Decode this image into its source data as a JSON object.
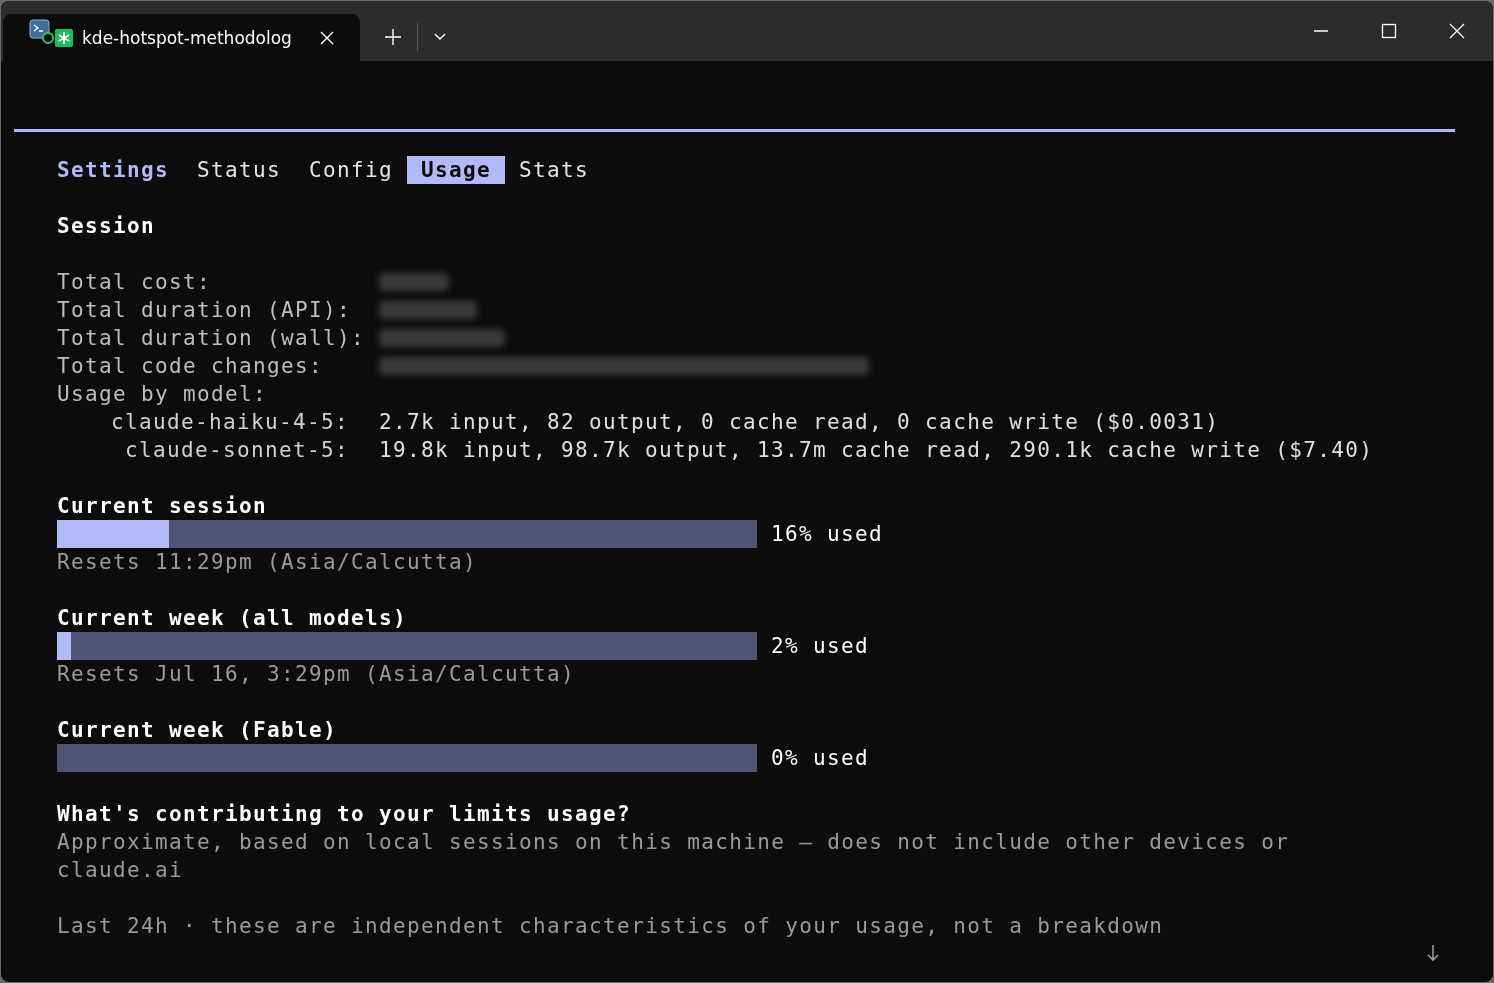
{
  "window": {
    "tab_title": "kde-hotspot-methodolog"
  },
  "nav_tabs": [
    {
      "label": "Settings",
      "kind": "heading",
      "selected": false
    },
    {
      "label": "Status",
      "kind": "tab",
      "selected": false
    },
    {
      "label": "Config",
      "kind": "tab",
      "selected": false
    },
    {
      "label": "Usage",
      "kind": "tab",
      "selected": true
    },
    {
      "label": "Stats",
      "kind": "tab",
      "selected": false
    }
  ],
  "session": {
    "heading": "Session",
    "rows": [
      {
        "label": "Total cost:",
        "redacted": true
      },
      {
        "label": "Total duration (API):",
        "redacted": true
      },
      {
        "label": "Total duration (wall):",
        "redacted": true
      },
      {
        "label": "Total code changes:",
        "redacted": true
      },
      {
        "label": "Usage by model:",
        "redacted": false
      }
    ],
    "models": [
      {
        "name": "claude-haiku-4-5:",
        "usage": "2.7k input, 82 output, 0 cache read, 0 cache write ($0.0031)"
      },
      {
        "name": "claude-sonnet-5:",
        "usage": "19.8k input, 98.7k output, 13.7m cache read, 290.1k cache write ($7.40)"
      }
    ]
  },
  "limits": [
    {
      "title": "Current session",
      "level": 0.16,
      "reading": "16% used",
      "reset": "Resets 11:29pm (Asia/Calcutta)"
    },
    {
      "title": "Current week (all models)",
      "level": 0.02,
      "reading": "2% used",
      "reset": "Resets Jul 16, 3:29pm (Asia/Calcutta)"
    },
    {
      "title": "Current week (Fable)",
      "level": 0,
      "reading": "0% used"
    }
  ],
  "contributing": {
    "heading": "What's contributing to your limits usage?",
    "note": "Approximate, based on local sessions on this machine — does not include other devices or claude.ai",
    "period": "Last 24h · these are independent characteristics of your usage, not a breakdown"
  }
}
